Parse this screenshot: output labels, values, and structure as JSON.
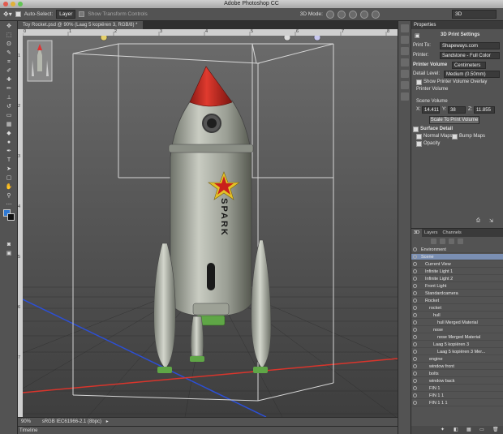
{
  "window": {
    "title": "Adobe Photoshop CC"
  },
  "options_bar": {
    "auto_select_label": "Auto-Select:",
    "layer_select": "Layer",
    "show_transform": "Show Transform Controls",
    "mode_label": "3D Mode:",
    "workspace": "3D"
  },
  "document": {
    "tab_title": "Toy Rocket.psd @ 90% (Laag 5 kopiëren 3, RGB/8) *",
    "zoom": "90%",
    "color_profile": "sRGB IEC61966-2.1 (8bpc)",
    "timeline_label": "Timeline",
    "ruler_h": [
      "0",
      "1",
      "2",
      "3",
      "4",
      "5",
      "6",
      "7",
      "8",
      "9",
      "10"
    ],
    "ruler_v": [
      "1",
      "2",
      "3",
      "4",
      "5",
      "6",
      "7"
    ],
    "rocket_text": "SPARK"
  },
  "properties": {
    "panel_title": "Properties",
    "section_title": "3D Print Settings",
    "print_to_label": "Print To:",
    "print_to_value": "Shapeways.com",
    "printer_label": "Printer:",
    "printer_value": "Sandstone - Full Color",
    "printer_volume_label": "Printer Volume",
    "printer_volume_unit": "Centimeters",
    "detail_level_label": "Detail Level:",
    "detail_level_value": "Medium (0.50mm)",
    "show_overlay_label": "Show Printer Volume Overlay",
    "printer_volume_sub": "Printer Volume",
    "scene_volume_label": "Scene Volume",
    "x_label": "X:",
    "x_value": "14.411",
    "y_label": "Y:",
    "y_value": "38",
    "z_label": "Z:",
    "z_value": "11.855",
    "scale_button": "Scale To Print Volume",
    "surface_detail_label": "Surface Detail",
    "normal_maps_label": "Normal Maps",
    "bump_maps_label": "Bump Maps",
    "opacity_label": "Opacity"
  },
  "panel3d": {
    "tabs": [
      "3D",
      "Layers",
      "Channels"
    ],
    "tree": [
      {
        "label": "Environment",
        "indent": 0
      },
      {
        "label": "Scene",
        "indent": 0,
        "selected": true
      },
      {
        "label": "Current View",
        "indent": 1
      },
      {
        "label": "Infinite Light 1",
        "indent": 1
      },
      {
        "label": "Infinite Light 2",
        "indent": 1
      },
      {
        "label": "Front Light",
        "indent": 1
      },
      {
        "label": "Standardcamera",
        "indent": 1
      },
      {
        "label": "Rocket",
        "indent": 1
      },
      {
        "label": "rocket",
        "indent": 2
      },
      {
        "label": "hull",
        "indent": 3
      },
      {
        "label": "hull Merged Material",
        "indent": 4
      },
      {
        "label": "nose",
        "indent": 3
      },
      {
        "label": "nose Merged Material",
        "indent": 4
      },
      {
        "label": "Laag 5 kopiëren 3",
        "indent": 3
      },
      {
        "label": "Laag 5 kopiëren 3 Mer...",
        "indent": 4
      },
      {
        "label": "engine",
        "indent": 2
      },
      {
        "label": "window front",
        "indent": 2
      },
      {
        "label": "bolts",
        "indent": 2
      },
      {
        "label": "window back",
        "indent": 2
      },
      {
        "label": "FIN 1",
        "indent": 2
      },
      {
        "label": "FIN 1 1",
        "indent": 2
      },
      {
        "label": "FIN 1 1 1",
        "indent": 2
      }
    ]
  },
  "colors": {
    "accent": "#7a8fb3",
    "panel": "#535353",
    "dark": "#3a3a3a"
  }
}
